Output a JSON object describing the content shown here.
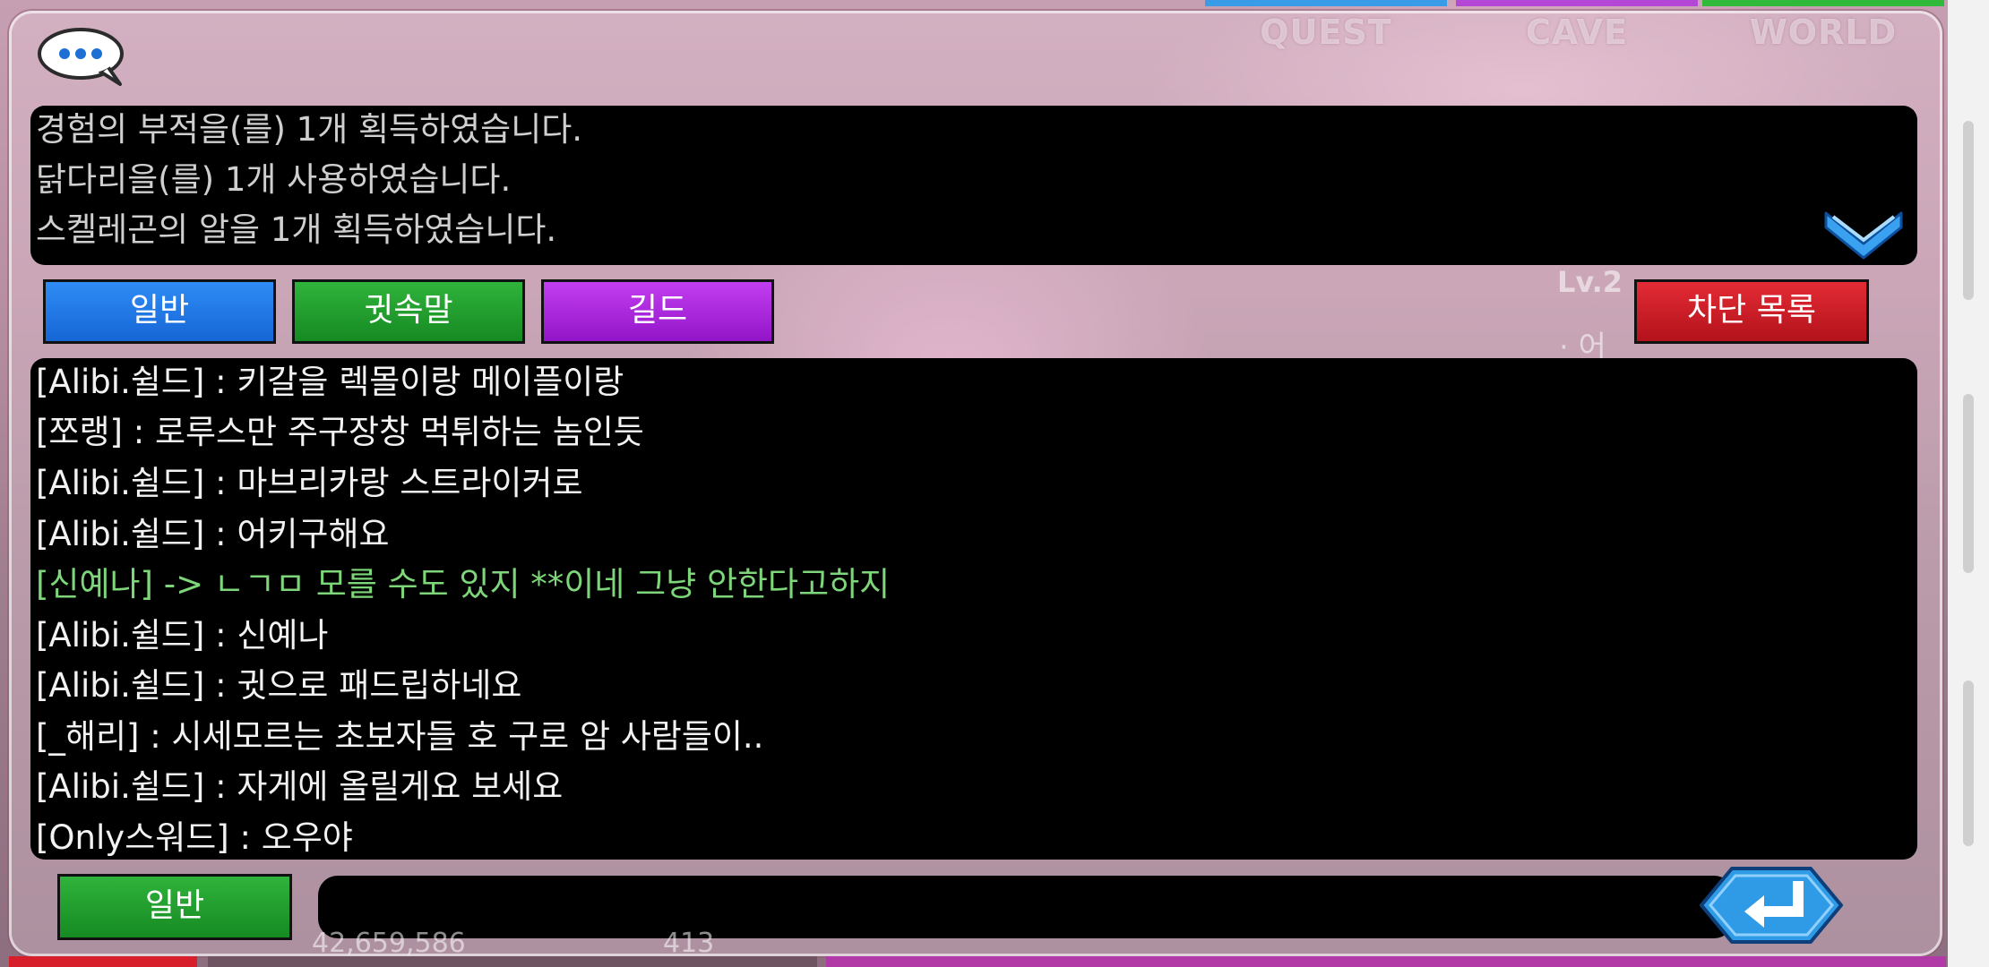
{
  "top_tabs": [
    "QUEST",
    "CAVE",
    "WORLD"
  ],
  "system_log": [
    "경험의 부적을(를) 1개 획득하였습니다.",
    "닭다리을(를) 1개 사용하였습니다.",
    "스켈레곤의 알을 1개 획득하였습니다."
  ],
  "channel_buttons": {
    "general": "일반",
    "whisper": "귓속말",
    "guild": "길드",
    "block_list": "차단 목록"
  },
  "background_hud": {
    "level": "Lv.2",
    "name_fragment": "· 어",
    "gold": "42,659,586",
    "gems": "413"
  },
  "chat_messages": [
    {
      "text": "[Alibi.쉴드] : 키갈을 렉몰이랑 메이플이랑",
      "type": "normal"
    },
    {
      "text": "[쪼랭] : 로루스만 주구장창 먹튀하는 놈인듯",
      "type": "normal"
    },
    {
      "text": "[Alibi.쉴드] : 마브리카랑 스트라이커로",
      "type": "normal"
    },
    {
      "text": "[Alibi.쉴드] : 어키구해요",
      "type": "normal"
    },
    {
      "text": "[신예나] -> ㄴㄱㅁ 모를 수도 있지 **이네 그냥 안한다고하지",
      "type": "whisper"
    },
    {
      "text": "[Alibi.쉴드] : 신예나",
      "type": "normal"
    },
    {
      "text": "[Alibi.쉴드] : 귓으로 패드립하네요",
      "type": "normal"
    },
    {
      "text": "[_해리] : 시세모르는 초보자들 호   구로 암 사람들이..",
      "type": "normal"
    },
    {
      "text": "[Alibi.쉴드] : 자게에 올릴게요 보세요",
      "type": "normal"
    },
    {
      "text": "[Only스워드] : 오우야",
      "type": "normal"
    }
  ],
  "input": {
    "channel_label": "일반",
    "value": "",
    "placeholder": ""
  },
  "icons": {
    "chat": "chat-bubble-icon",
    "collapse": "chevron-down-icon",
    "send": "enter-arrow-icon"
  },
  "colors": {
    "general": "#1f78e8",
    "whisper": "#1f9e2b",
    "guild": "#a51fd9",
    "block": "#cc1a24",
    "whisper_text": "#7ed67a"
  }
}
